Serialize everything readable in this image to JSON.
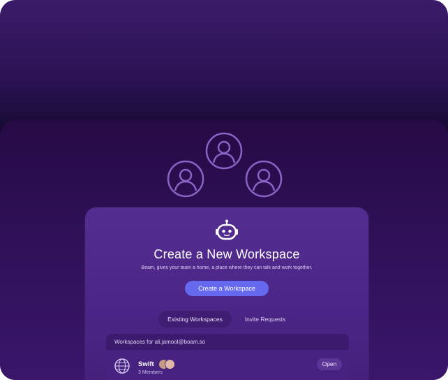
{
  "header_icons": [
    "user-circle-icon",
    "user-circle-icon",
    "user-circle-icon"
  ],
  "card": {
    "icon": "robot-icon",
    "title": "Create a New Workspace",
    "subtitle": "Beam, gives your team a home, a place where they can talk and work together.",
    "create_button": "Create a Workspace"
  },
  "tabs": [
    {
      "label": "Existing Workspaces",
      "active": true
    },
    {
      "label": "Invite Requests",
      "active": false
    }
  ],
  "workspaces_panel": {
    "header": "Workspaces for ali.jamool@boam.so",
    "items": [
      {
        "name": "Swift",
        "members": "3 Members",
        "icon": "globe-icon",
        "action": "Open"
      }
    ]
  },
  "colors": {
    "accent": "#6469ee",
    "card_bg": "#542d91",
    "background": "#13072c"
  }
}
